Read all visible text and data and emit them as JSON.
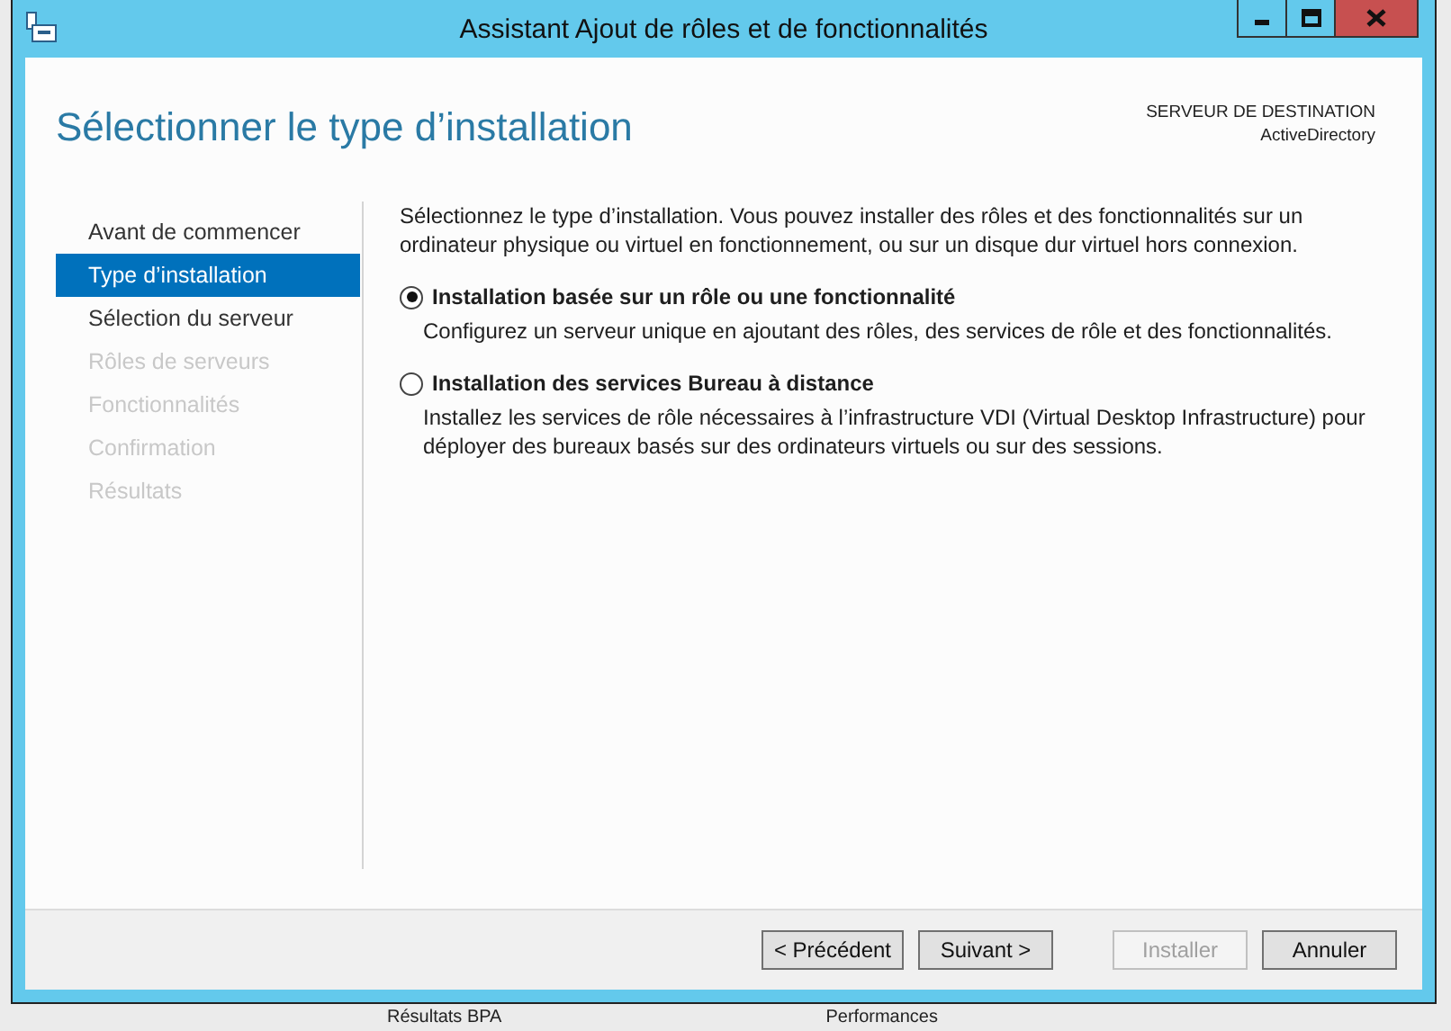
{
  "window": {
    "title": "Assistant Ajout de rôles et de fonctionnalités"
  },
  "page_title": "Sélectionner le type d’installation",
  "destination": {
    "label": "SERVEUR DE DESTINATION",
    "server": "ActiveDirectory"
  },
  "steps": [
    {
      "label": "Avant de commencer",
      "selected": false,
      "disabled": false
    },
    {
      "label": "Type d’installation",
      "selected": true,
      "disabled": false
    },
    {
      "label": "Sélection du serveur",
      "selected": false,
      "disabled": false
    },
    {
      "label": "Rôles de serveurs",
      "selected": false,
      "disabled": true
    },
    {
      "label": "Fonctionnalités",
      "selected": false,
      "disabled": true
    },
    {
      "label": "Confirmation",
      "selected": false,
      "disabled": true
    },
    {
      "label": "Résultats",
      "selected": false,
      "disabled": true
    }
  ],
  "intro": "Sélectionnez le type d’installation. Vous pouvez installer des rôles et des fonctionnalités sur un ordinateur physique ou virtuel en fonctionnement, ou sur un disque dur virtuel hors connexion.",
  "options": [
    {
      "label": "Installation basée sur un rôle ou une fonctionnalité",
      "description": "Configurez un serveur unique en ajoutant des rôles, des services de rôle et des fonctionnalités.",
      "selected": true
    },
    {
      "label": "Installation des services Bureau à distance",
      "description": "Installez les services de rôle nécessaires à l’infrastructure VDI (Virtual Desktop Infrastructure) pour déployer des bureaux basés sur des ordinateurs virtuels ou sur des sessions.",
      "selected": false
    }
  ],
  "buttons": [
    {
      "label": "< Précédent",
      "disabled": false
    },
    {
      "label": "Suivant >",
      "disabled": false
    },
    {
      "label": "Installer",
      "disabled": true
    },
    {
      "label": "Annuler",
      "disabled": false
    }
  ],
  "background_labels": [
    "Résultats BPA",
    "Performances"
  ]
}
